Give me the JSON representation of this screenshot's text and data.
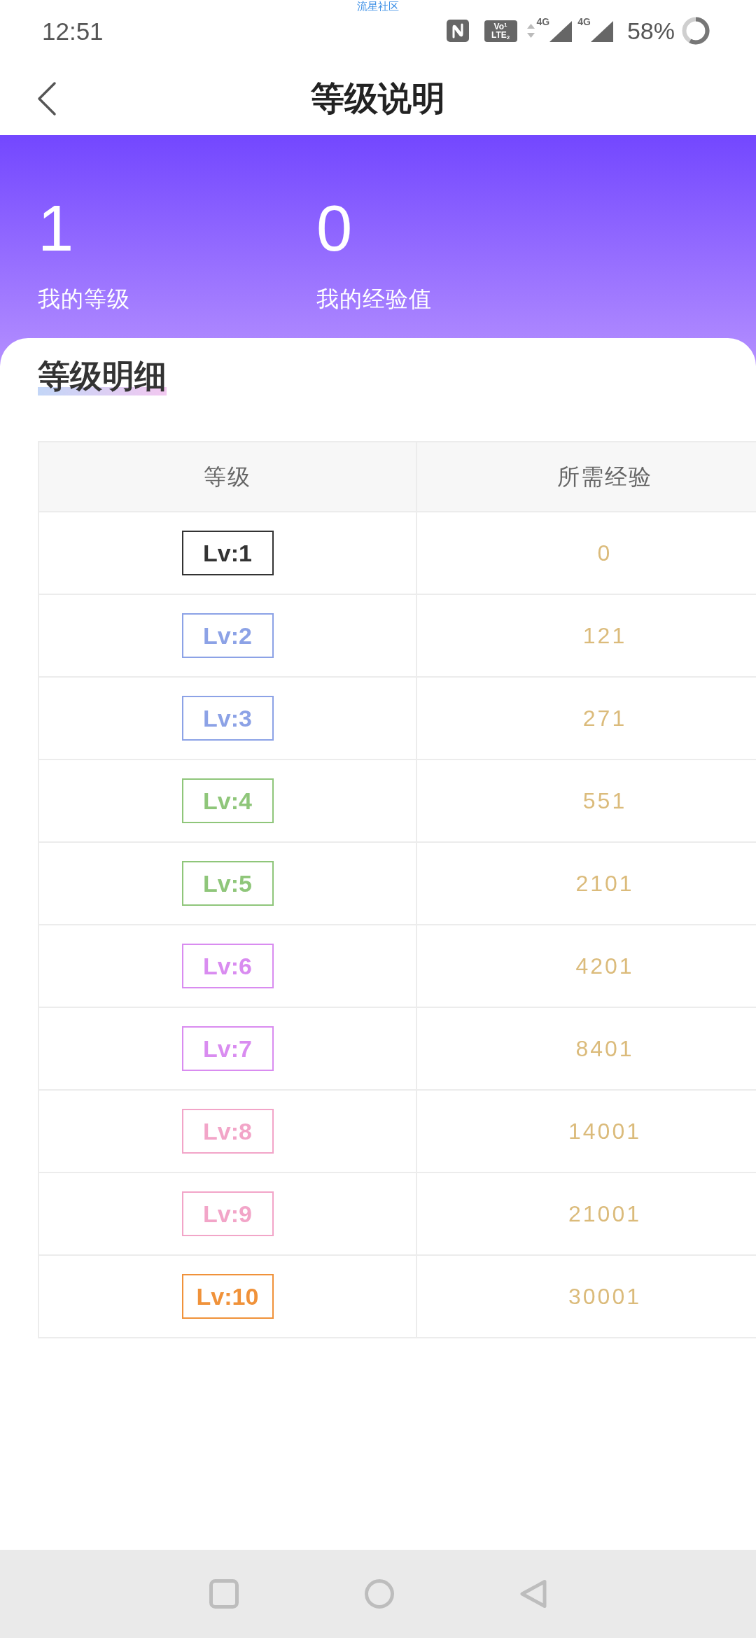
{
  "status_bar": {
    "carrier_label": "流星社区",
    "time": "12:51",
    "volte": [
      "Vo$^{1}$",
      "LTE$_{2}$"
    ],
    "signals": [
      {
        "label": "4G",
        "activity": true
      },
      {
        "label": "4G",
        "activity": false
      }
    ],
    "battery": "58%"
  },
  "header": {
    "title": "等级说明"
  },
  "summary": [
    {
      "value": "1",
      "label": "我的等级"
    },
    {
      "value": "0",
      "label": "我的经验值"
    }
  ],
  "section": {
    "title": "等级明细"
  },
  "table": {
    "columns": [
      "等级",
      "所需经验"
    ],
    "rows": [
      {
        "level": "Lv:1",
        "color": "#333333",
        "exp": "0"
      },
      {
        "level": "Lv:2",
        "color": "#8ca2e6",
        "exp": "121"
      },
      {
        "level": "Lv:3",
        "color": "#8ca2e6",
        "exp": "271"
      },
      {
        "level": "Lv:4",
        "color": "#8fc67a",
        "exp": "551"
      },
      {
        "level": "Lv:5",
        "color": "#8fc67a",
        "exp": "2101"
      },
      {
        "level": "Lv:6",
        "color": "#d98cf0",
        "exp": "4201"
      },
      {
        "level": "Lv:7",
        "color": "#d98cf0",
        "exp": "8401"
      },
      {
        "level": "Lv:8",
        "color": "#f2a5c8",
        "exp": "14001"
      },
      {
        "level": "Lv:9",
        "color": "#f2a5c8",
        "exp": "21001"
      },
      {
        "level": "Lv:10",
        "color": "#f0923a",
        "exp": "30001"
      }
    ]
  }
}
